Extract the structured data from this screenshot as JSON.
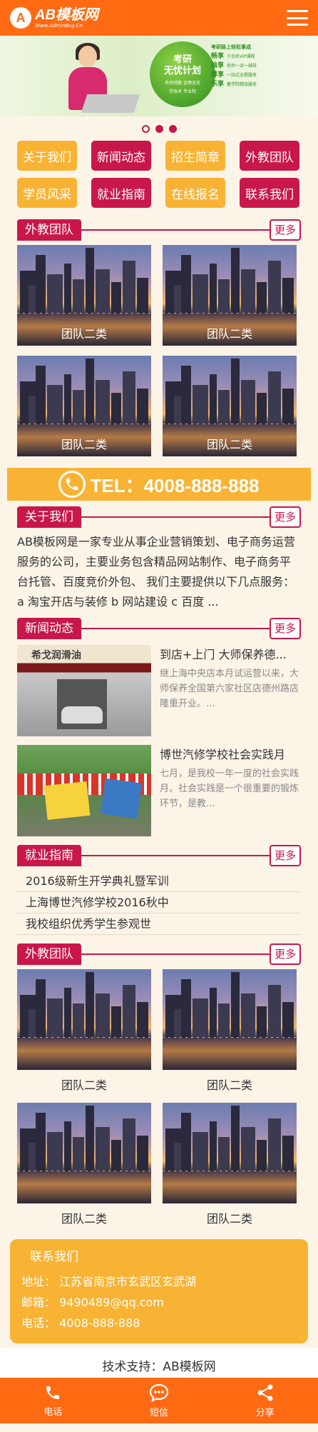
{
  "header": {
    "logo_mark": "A",
    "logo_name": "AB模板网",
    "logo_url": "Www.AdminBuy.Cn"
  },
  "banner": {
    "globe_line1": "考研",
    "globe_line2": "无忧计划",
    "globe_line3": "名师领路 金榜无忧",
    "globe_line4": "学技术  专业院",
    "features_title": "考研路上轻松事成",
    "features": [
      {
        "key": "畅享",
        "text": "千余名VIP课程"
      },
      {
        "key": "独享",
        "text": "名师一对一辅导"
      },
      {
        "key": "尊享",
        "text": "一站式全程服务"
      },
      {
        "key": "乐享",
        "text": "著学院精品服务"
      }
    ]
  },
  "carousel": {
    "count": 3,
    "active_index": 3
  },
  "nav": [
    {
      "label": "关于我们",
      "color": "yellow"
    },
    {
      "label": "新闻动态",
      "color": "crimson"
    },
    {
      "label": "招生简章",
      "color": "yellow"
    },
    {
      "label": "外教团队",
      "color": "crimson"
    },
    {
      "label": "学员风采",
      "color": "yellow"
    },
    {
      "label": "就业指南",
      "color": "crimson"
    },
    {
      "label": "在线报名",
      "color": "yellow"
    },
    {
      "label": "联系我们",
      "color": "crimson"
    }
  ],
  "more_label": "更多",
  "sections": {
    "team1": {
      "title": "外教团队",
      "cards": [
        "团队二类",
        "团队二类",
        "团队二类",
        "团队二类"
      ]
    },
    "about": {
      "title": "关于我们",
      "text": "AB模板网是一家专业从事企业营销策划、电子商务运营服务的公司，主要业务包含精品网站制作、电子商务平台托管、百度竞价外包、 我们主要提供以下几点服务： a 淘宝开店与装修 b 网站建设 c 百度 ..."
    },
    "news": {
      "title": "新闻动态",
      "items": [
        {
          "title": "到店+上门 大师保养德...",
          "desc": "继上海中央店本月试运营以来，大师保养全国第六家社区店德州路店隆重开业。...",
          "img_sign": "希戈润滑油"
        },
        {
          "title": "博世汽修学校社会实践月",
          "desc": "七月，是我校一年一度的社会实践月。社会实践是一个很重要的锻炼环节，是教..."
        }
      ]
    },
    "guide": {
      "title": "就业指南",
      "items": [
        "2016级新生开学典礼暨军训",
        "上海博世汽修学校2016秋中",
        "我校组织优秀学生参观世"
      ]
    },
    "team2": {
      "title": "外教团队",
      "cards": [
        "团队二类",
        "团队二类",
        "团队二类",
        "团队二类"
      ]
    }
  },
  "tel": {
    "text": "TEL：4008-888-888"
  },
  "contact": {
    "title": "联系我们",
    "address": "地址：  江苏省南京市玄武区玄武湖",
    "email": "邮箱：  9490489@qq.com",
    "phone": "电话：  4008-888-888"
  },
  "support": "技术支持：AB模板网",
  "footer": [
    {
      "label": "电话",
      "icon": "phone-icon"
    },
    {
      "label": "短信",
      "icon": "message-icon"
    },
    {
      "label": "分享",
      "icon": "share-icon"
    }
  ],
  "colors": {
    "orange": "#ff6a13",
    "crimson": "#c8174a",
    "yellow": "#f8b334",
    "bg": "#fdf4e8"
  }
}
